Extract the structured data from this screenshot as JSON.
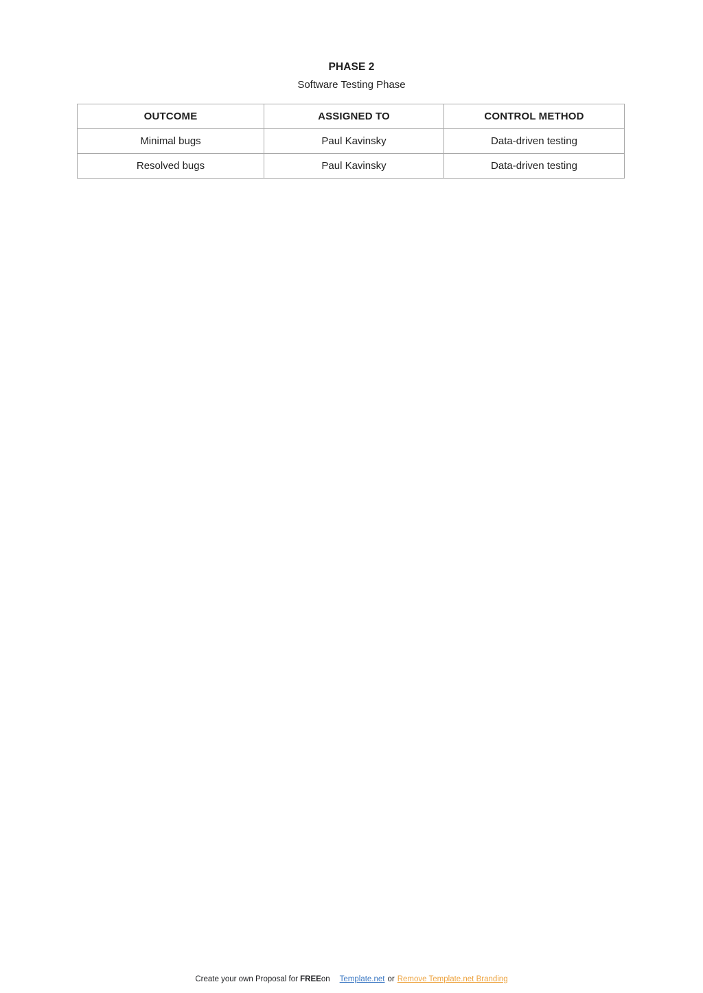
{
  "document": {
    "title": "PHASE 2",
    "subtitle": "Software Testing Phase"
  },
  "table": {
    "headers": [
      "OUTCOME",
      "ASSIGNED TO",
      "CONTROL METHOD"
    ],
    "rows": [
      {
        "outcome": "Minimal bugs",
        "assigned_to": "Paul Kavinsky",
        "control_method": "Data-driven testing"
      },
      {
        "outcome": "Resolved bugs",
        "assigned_to": "Paul Kavinsky",
        "control_method": "Data-driven testing"
      }
    ]
  },
  "footer": {
    "prefix": "Create your own Proposal for",
    "free_label": "FREE",
    "on_label": "on",
    "template_link": "Template.net",
    "or_label": "or",
    "remove_branding_link": "Remove Template.net Branding",
    "colors": {
      "template_link": "#3b78c3",
      "remove_branding_link": "#eda33f",
      "text": "#202124"
    }
  },
  "style": {
    "border_color": "#a8a8a8",
    "text_color": "#1f1f1f",
    "background": "#ffffff"
  }
}
